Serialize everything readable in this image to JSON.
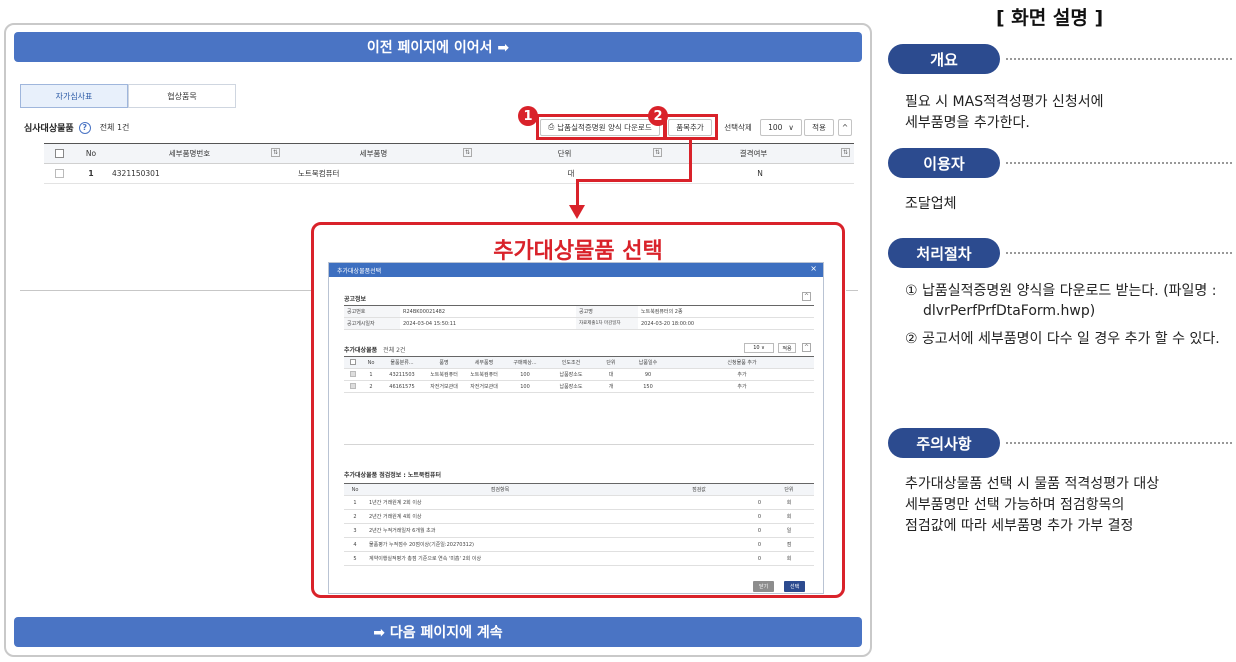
{
  "top_bar": "이전 페이지에 이어서 ➡",
  "bottom_bar": "➡ 다음 페이지에 계속",
  "tabs": [
    "자가심사표",
    "협상품목"
  ],
  "list": {
    "title": "심사대상물품",
    "help_icon": "?",
    "count": "전체 1건",
    "buttons": {
      "download": "납품실적증명원 양식 다운로드",
      "add_item": "품목추가",
      "delete": "선택삭제",
      "page_size": "100",
      "apply": "적용",
      "collapse": "^"
    },
    "badges": [
      "1",
      "2"
    ],
    "columns": [
      "No",
      "세부품명번호",
      "세부품명",
      "단위",
      "결격여부"
    ],
    "rows": [
      {
        "no": "1",
        "code": "4321150301",
        "name": "노트북컴퓨터",
        "unit": "대",
        "status": "N"
      }
    ]
  },
  "popup": {
    "callout_title": "추가대상물품 선택",
    "window_title": "추가대상물품선택",
    "close": "×",
    "notice": {
      "section": "공고정보",
      "rows": [
        {
          "l1": "공고번호",
          "v1": "R24BK00021482",
          "l2": "공고명",
          "v2": "노트북컴퓨터의 2종"
        },
        {
          "l1": "공고게시일자",
          "v1": "2024-03-04 15:50:11",
          "l2": "자료제출1차 마감일자",
          "v2": "2024-03-20 18:00:00"
        }
      ]
    },
    "targets": {
      "section": "추가대상물품",
      "count": "전체 2건",
      "page_size": "10",
      "apply": "적용",
      "columns": [
        "No",
        "물품분류...",
        "품명",
        "세부품명",
        "구매예상...",
        "인도조건",
        "단위",
        "납품일수",
        "신청물품 추가"
      ],
      "rows": [
        {
          "no": "1",
          "cls": "43211503",
          "item": "노트북컴퓨터",
          "detail": "노트북컴퓨터",
          "qty": "100",
          "cond": "납품장소도",
          "unit": "대",
          "days": "90",
          "add": "추가"
        },
        {
          "no": "2",
          "cls": "46161575",
          "item": "자전거보관대",
          "detail": "자전거보관대",
          "qty": "100",
          "cond": "납품장소도",
          "unit": "개",
          "days": "150",
          "add": "추가"
        }
      ]
    },
    "inspection": {
      "section": "추가대상물품 점검정보 : 노트북컴퓨터",
      "columns": [
        "No",
        "점검항목",
        "점검값",
        "단위"
      ],
      "rows": [
        {
          "no": "1",
          "item": "1년간 거래원계 2회 이상",
          "value": "0",
          "unit": "회"
        },
        {
          "no": "2",
          "item": "2년간 거래원계 4회 이상",
          "value": "0",
          "unit": "회"
        },
        {
          "no": "3",
          "item": "2년간 누적거래일자 6개월 초과",
          "value": "0",
          "unit": "일"
        },
        {
          "no": "4",
          "item": "물품평가 누적점수 20점이상(기준일:20270312)",
          "value": "0",
          "unit": "점"
        },
        {
          "no": "5",
          "item": "계약이행실적평가 총점 기준으로 연속 '미흡' 2회 이상",
          "value": "0",
          "unit": "회"
        }
      ]
    },
    "buttons": {
      "close": "닫기",
      "select": "선택"
    }
  },
  "description": {
    "title": "[ 화면 설명 ]",
    "overview_label": "개요",
    "overview_text": [
      "필요 시 MAS적격성평가 신청서에",
      "세부품명을 추가한다."
    ],
    "user_label": "이용자",
    "user_text": "조달업체",
    "procedure_label": "처리절차",
    "procedure_items": [
      "① 납품실적증명원 양식을 다운로드 받는다. (파일명 : dlvrPerfPrfDtaForm.hwp)",
      "② 공고서에 세부품명이 다수 일 경우 추가 할 수 있다."
    ],
    "caution_label": "주의사항",
    "caution_text": [
      "추가대상물품 선택 시 물품 적격성평가 대상",
      "세부품명만 선택 가능하며 점검항목의",
      "점검값에 따라 세부품명 추가 가부 결정"
    ]
  },
  "colors": {
    "accent_bar": "#4a74c4",
    "highlight": "#d9222a",
    "pill": "#2c4b8f",
    "modal_header": "#3d6fc0"
  }
}
